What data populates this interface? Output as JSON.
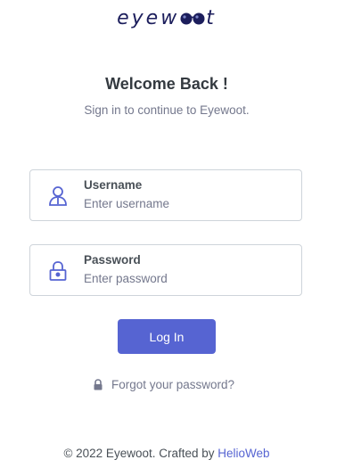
{
  "brand": {
    "prefix": "eyew",
    "suffix": "t",
    "glasses_icon": "sunglasses-icon"
  },
  "header": {
    "title": "Welcome Back !",
    "subtitle": "Sign in to continue to Eyewoot."
  },
  "form": {
    "username": {
      "label": "Username",
      "placeholder": "Enter username",
      "value": "",
      "icon": "user-icon"
    },
    "password": {
      "label": "Password",
      "placeholder": "Enter password",
      "value": "",
      "icon": "lock-icon"
    },
    "submit_label": "Log In",
    "forgot_label": "Forgot your password?"
  },
  "footer": {
    "text": "© 2022 Eyewoot. Crafted by",
    "link_label": "HelioWeb"
  },
  "colors": {
    "primary": "#5664d2",
    "logo": "#1c1e5c",
    "muted": "#74788d",
    "border": "#ced4da"
  }
}
